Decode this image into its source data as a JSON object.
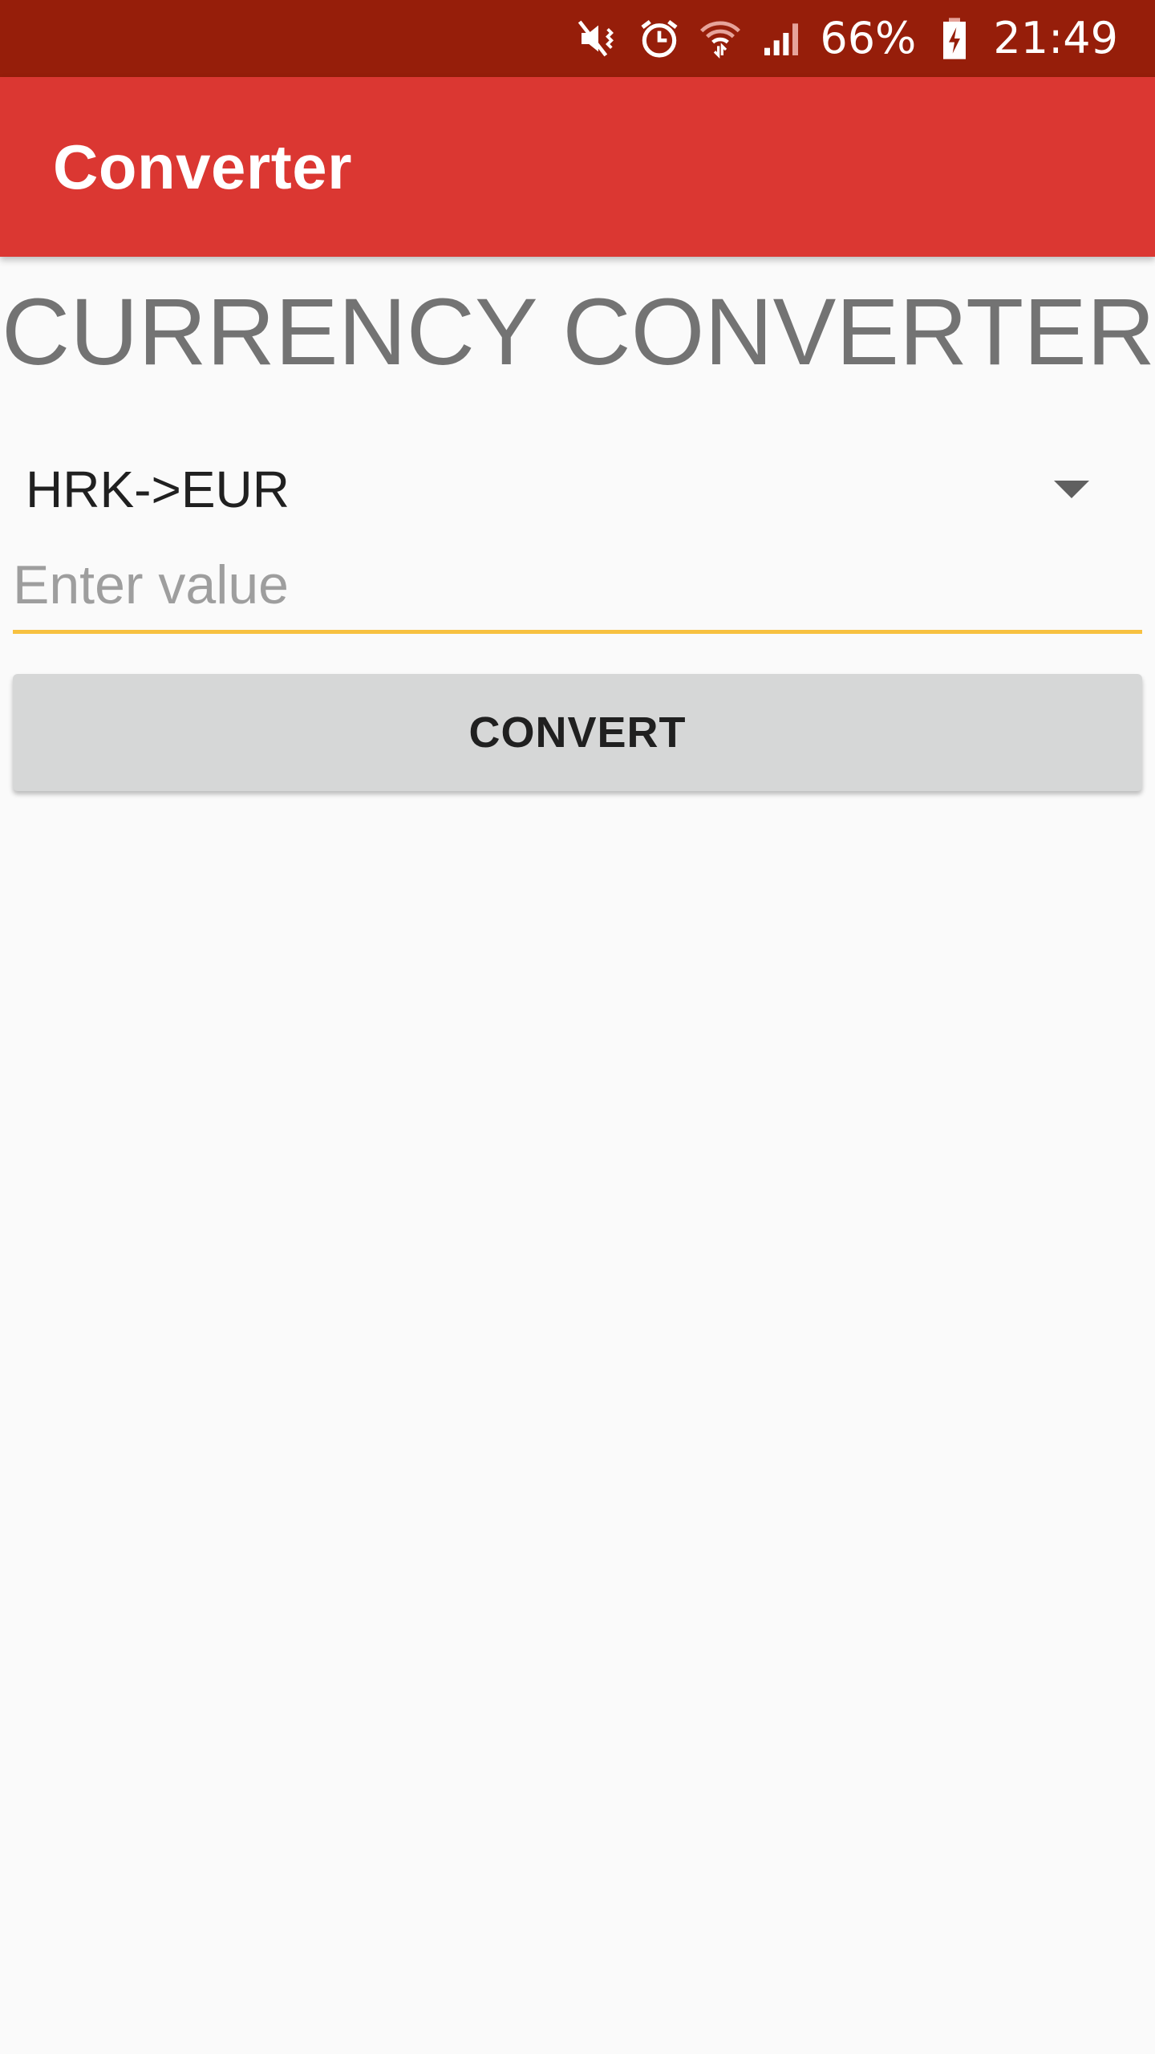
{
  "status_bar": {
    "icons": [
      "mute-vibrate-icon",
      "alarm-icon",
      "wifi-icon",
      "cell-signal-icon"
    ],
    "battery_percent": "66%",
    "time": "21:49",
    "background": "#961e0a"
  },
  "app_bar": {
    "title": "Converter",
    "color": "#db3732"
  },
  "main": {
    "heading": "CURRENCY CONVERTER",
    "spinner": {
      "selected": "HRK->EUR"
    },
    "value_input": {
      "placeholder": "Enter value",
      "value": ""
    },
    "convert_button": {
      "label": "CONVERT"
    },
    "accent_color": "#f7c140"
  }
}
